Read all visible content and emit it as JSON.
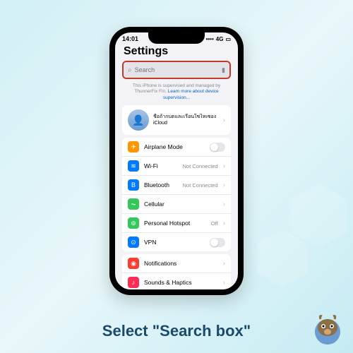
{
  "caption": "Select \"Search box\"",
  "statusbar": {
    "time": "14:01",
    "net": "4G",
    "signal": "••••"
  },
  "header": {
    "title": "Settings"
  },
  "search": {
    "placeholder": "Search"
  },
  "supervised": {
    "text": "This iPhone is supervised and managed by ThunnerFix Fin.",
    "link": "Learn more about device supervision..."
  },
  "profile": {
    "name": "ชื่อถ้ากบตและเรือนใชไหเซอง iCloud"
  },
  "rows": {
    "airplane": {
      "label": "Airplane Mode",
      "color": "#ff9500",
      "glyph": "✈"
    },
    "wifi": {
      "label": "Wi-Fi",
      "value": "Not Connected",
      "color": "#007aff",
      "glyph": "≋"
    },
    "bt": {
      "label": "Bluetooth",
      "value": "Not Connected",
      "color": "#007aff",
      "glyph": "B"
    },
    "cell": {
      "label": "Cellular",
      "color": "#34c759",
      "glyph": "⏦"
    },
    "hotspot": {
      "label": "Personal Hotspot",
      "value": "Off",
      "color": "#34c759",
      "glyph": "⊚"
    },
    "vpn": {
      "label": "VPN",
      "color": "#007aff",
      "glyph": "⊙"
    },
    "notif": {
      "label": "Notifications",
      "color": "#ff3b30",
      "glyph": "◉"
    },
    "sounds": {
      "label": "Sounds & Haptics",
      "color": "#ff2d55",
      "glyph": "♪"
    }
  }
}
